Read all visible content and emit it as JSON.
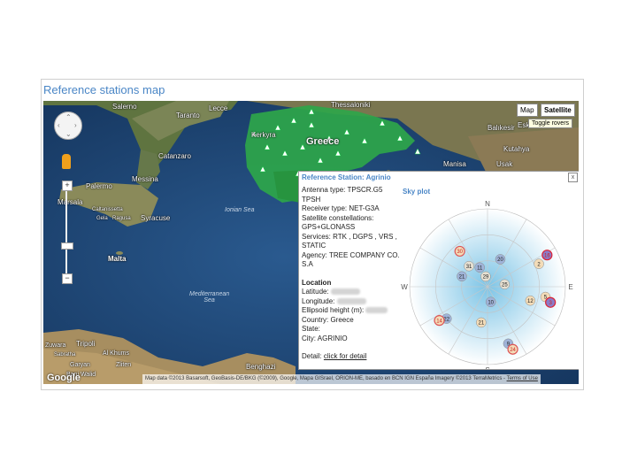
{
  "header": {
    "title": "Reference stations map"
  },
  "map": {
    "type_buttons": [
      "Map",
      "Satellite"
    ],
    "tooltip": "Toggle rovers",
    "pan_icon": "pan-arrows-icon",
    "pegman_icon": "pegman-icon",
    "zoom_in": "+",
    "zoom_out": "−",
    "labels": {
      "salerno": "Salerno",
      "taranto": "Taranto",
      "lecce": "Lecce",
      "thessaloniki": "Thessaloniki",
      "catanzaro": "Catanzaro",
      "kerkyra": "Kerkyra",
      "greece": "Greece",
      "balikesir": "Balıkesir",
      "eskisehir": "Esk",
      "kutahya": "Kutahya",
      "manisa": "Manisa",
      "usak": "Usak",
      "palermo": "Palermo",
      "messina": "Messina",
      "marsala": "Marsala",
      "caltanissetta": "Caltanissetta",
      "gela": "Gela",
      "ragusa": "Ragusa",
      "syracuse": "Syracuse",
      "ionian_sea": "Ionian Sea",
      "malta": "Malta",
      "mediterranean_sea": "Mediterranean\nSea",
      "zuwara": "Zuwara",
      "tripoli": "Tripoli",
      "sabratha": "Sabratha",
      "al_khums": "Al Khums",
      "garyan": "Garyan",
      "zliten": "Zliten",
      "bani_walid": "Bani Walid",
      "benghazi": "Benghazi"
    },
    "google_logo": "Google",
    "attribution": "Map data ©2013 Basarsoft, GeoBasis-DE/BKG (©2009), Google, Mapa GISrael, ORION-ME, basado en BCN IGN España Imagery ©2013 TerraMetrics - ",
    "terms_link": "Terms of Use"
  },
  "popup": {
    "title": "Reference Station: Agrinio",
    "close_label": "x",
    "antenna_type": "Antenna type: TPSCR.G5 TPSH",
    "receiver_type": "Receiver type: NET-G3A",
    "constellations": "Satellite constellations: GPS+GLONASS",
    "services": "Services: RTK , DGPS , VRS , STATIC",
    "agency": "Agency: TREE COMPANY CO. S.A",
    "location_heading": "Location",
    "latitude_label": "Latitude:",
    "longitude_label": "Longitude:",
    "ellipsoid_label": "Ellipsoid height (m):",
    "country": "Country: Greece",
    "state": "State:",
    "city": "City: AGRINIO",
    "detail_label": "Detail:",
    "detail_link": "click for detail",
    "sky_title": "Sky plot",
    "compass": {
      "n": "N",
      "s": "S",
      "e": "E",
      "w": "W"
    },
    "satellites": [
      {
        "id": "16",
        "az": 62,
        "el": 12,
        "color": "#8a7cc9",
        "ring": "#d23"
      },
      {
        "id": "2",
        "az": 66,
        "el": 25,
        "color": "#f3dcb8",
        "ring": ""
      },
      {
        "id": "30",
        "az": -38,
        "el": 38,
        "color": "#f3dcb8",
        "ring": "#d55"
      },
      {
        "id": "20",
        "az": 25,
        "el": 55,
        "color": "#9fb3d8",
        "ring": ""
      },
      {
        "id": "31",
        "az": -42,
        "el": 58,
        "color": "#e6e0d2",
        "ring": ""
      },
      {
        "id": "11",
        "az": -22,
        "el": 66,
        "color": "#9fb3d8",
        "ring": ""
      },
      {
        "id": "29",
        "az": -10,
        "el": 78,
        "color": "#e6e0d2",
        "ring": ""
      },
      {
        "id": "21",
        "az": -68,
        "el": 58,
        "color": "#9fb3d8",
        "ring": ""
      },
      {
        "id": "25",
        "az": 82,
        "el": 70,
        "color": "#e6e0d2",
        "ring": ""
      },
      {
        "id": "5",
        "az": 100,
        "el": 22,
        "color": "#f3dcb8",
        "ring": ""
      },
      {
        "id": "3",
        "az": 104,
        "el": 15,
        "color": "#8a7cc9",
        "ring": "#d23"
      },
      {
        "id": "12",
        "az": 108,
        "el": 38,
        "color": "#f3dcb8",
        "ring": ""
      },
      {
        "id": "10",
        "az": 168,
        "el": 72,
        "color": "#9fb3d8",
        "ring": ""
      },
      {
        "id": "22",
        "az": -128,
        "el": 30,
        "color": "#9fb3d8",
        "ring": ""
      },
      {
        "id": "14",
        "az": -125,
        "el": 22,
        "color": "#f3dcb8",
        "ring": "#d55"
      },
      {
        "id": "21",
        "az": -170,
        "el": 48,
        "color": "#f3dcb8",
        "ring": ""
      },
      {
        "id": "9",
        "az": 160,
        "el": 20,
        "color": "#9fb3d8",
        "ring": ""
      },
      {
        "id": "24",
        "az": 158,
        "el": 12,
        "color": "#f3dcb8",
        "ring": "#d55"
      }
    ]
  }
}
